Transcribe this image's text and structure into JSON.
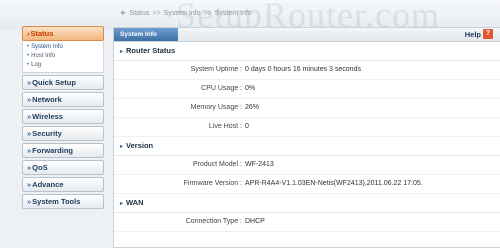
{
  "breadcrumb": {
    "parts": [
      "Status",
      ">>",
      "System Info",
      ">>",
      "System Info"
    ]
  },
  "watermark": "SetupRouter.com",
  "sidebar": {
    "items": [
      {
        "label": "Status",
        "prefix": "›",
        "active": true,
        "sub": [
          {
            "label": "System Info",
            "on": true
          },
          {
            "label": "Host Info",
            "on": false
          },
          {
            "label": "Log",
            "on": false
          }
        ]
      },
      {
        "label": "Quick Setup",
        "prefix": "»"
      },
      {
        "label": "Network",
        "prefix": "»"
      },
      {
        "label": "Wireless",
        "prefix": "»"
      },
      {
        "label": "Security",
        "prefix": "»"
      },
      {
        "label": "Forwarding",
        "prefix": "»"
      },
      {
        "label": "QoS",
        "prefix": "»"
      },
      {
        "label": "Advance",
        "prefix": "»"
      },
      {
        "label": "System Tools",
        "prefix": "»"
      }
    ]
  },
  "main": {
    "tab": "System Info",
    "help": {
      "label": "Help",
      "icon": "?"
    },
    "sections": [
      {
        "title": "Router Status",
        "rows": [
          {
            "label": "System Uptime :",
            "value": "0 days 0 hours 16 minutes 3 seconds"
          },
          {
            "label": "CPU Usage :",
            "value": "0%"
          },
          {
            "label": "Memory Usage :",
            "value": "26%"
          },
          {
            "label": "Live Host :",
            "value": "0"
          }
        ]
      },
      {
        "title": "Version",
        "rows": [
          {
            "label": "Product Model :",
            "value": "WF-2413"
          },
          {
            "label": "Firmware Version :",
            "value": "APR-R4A4-V1.1.03EN-Netis(WF2413),2011.06.22 17:05."
          }
        ]
      },
      {
        "title": "WAN",
        "rows": [
          {
            "label": "Connection Type :",
            "value": "DHCP"
          }
        ]
      }
    ]
  },
  "colors": {
    "accent": "#3d6fa3",
    "active_menu": "#f3b67d",
    "help_icon": "#e3562d"
  }
}
